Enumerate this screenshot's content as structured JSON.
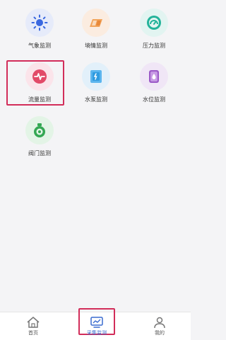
{
  "modules": [
    {
      "label": "气象监测",
      "icon": "sun-icon",
      "bg": "#e6ebfa",
      "color": "#3a68e0"
    },
    {
      "label": "墒情监测",
      "icon": "soil-icon",
      "bg": "#fbece0",
      "color": "#e8883a"
    },
    {
      "label": "压力监测",
      "icon": "gauge-icon",
      "bg": "#e2f4f1",
      "color": "#23b39a"
    },
    {
      "label": "流量监测",
      "icon": "pulse-icon",
      "bg": "#fbe4ea",
      "color": "#e24a68"
    },
    {
      "label": "水泵监测",
      "icon": "pump-icon",
      "bg": "#e2f0fa",
      "color": "#2f9be0"
    },
    {
      "label": "水位监测",
      "icon": "water-level-icon",
      "bg": "#f0e6f6",
      "color": "#9b59c7"
    },
    {
      "label": "阀门监测",
      "icon": "valve-icon",
      "bg": "#e3f4e6",
      "color": "#34a853"
    }
  ],
  "tabbar": {
    "items": [
      {
        "label": "首页",
        "icon": "home-icon"
      },
      {
        "label": "采集监测",
        "icon": "monitor-icon"
      },
      {
        "label": "我的",
        "icon": "user-icon"
      }
    ],
    "active_color": "#3a6ccf",
    "inactive_color": "#777777"
  },
  "highlight_color": "#d22d5a"
}
